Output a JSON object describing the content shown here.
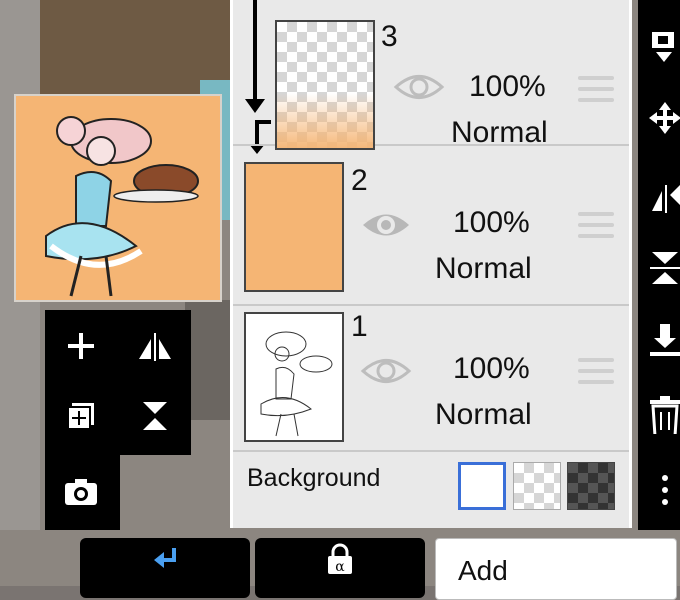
{
  "layers": [
    {
      "number": "3",
      "opacity": "100%",
      "blend": "Normal"
    },
    {
      "number": "2",
      "opacity": "100%",
      "blend": "Normal"
    },
    {
      "number": "1",
      "opacity": "100%",
      "blend": "Normal"
    }
  ],
  "background": {
    "label": "Background"
  },
  "bottom": {
    "add_label": "Add"
  },
  "colors": {
    "layer2_fill": "#f5b574",
    "selected_outline": "#3a6fd8",
    "panel_bg": "#e9e9e9"
  }
}
